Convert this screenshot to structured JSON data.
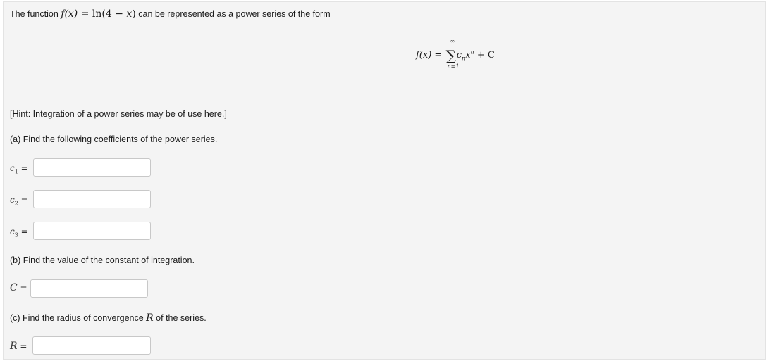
{
  "intro": {
    "text_before": "The function ",
    "func_lhs": "f(x)",
    "func_eq": " = ln(4 − ",
    "func_var": "x",
    "func_close": ")",
    "text_after": " can be represented as a power series of the form"
  },
  "formula": {
    "lhs": "f(x)",
    "eq": " = ",
    "sigma_top": "∞",
    "sigma_bottom": "n=1",
    "term_c": "c",
    "term_c_sub": "n",
    "term_x": "x",
    "term_x_sup": "n",
    "plus_c": " + C"
  },
  "hint": "[Hint: Integration of a power series may be of use here.]",
  "part_a": {
    "prompt": "(a) Find the following coefficients of the power series.",
    "fields": [
      {
        "var": "c",
        "sub": "1",
        "eq": " =",
        "value": ""
      },
      {
        "var": "c",
        "sub": "2",
        "eq": " =",
        "value": ""
      },
      {
        "var": "c",
        "sub": "3",
        "eq": " =",
        "value": ""
      }
    ]
  },
  "part_b": {
    "prompt": "(b) Find the value of the constant of integration.",
    "var": "C",
    "eq": " =",
    "value": ""
  },
  "part_c": {
    "prompt_before": "(c) Find the radius of convergence ",
    "prompt_var": "R",
    "prompt_after": " of the series.",
    "var": "R",
    "eq": " =",
    "value": ""
  }
}
